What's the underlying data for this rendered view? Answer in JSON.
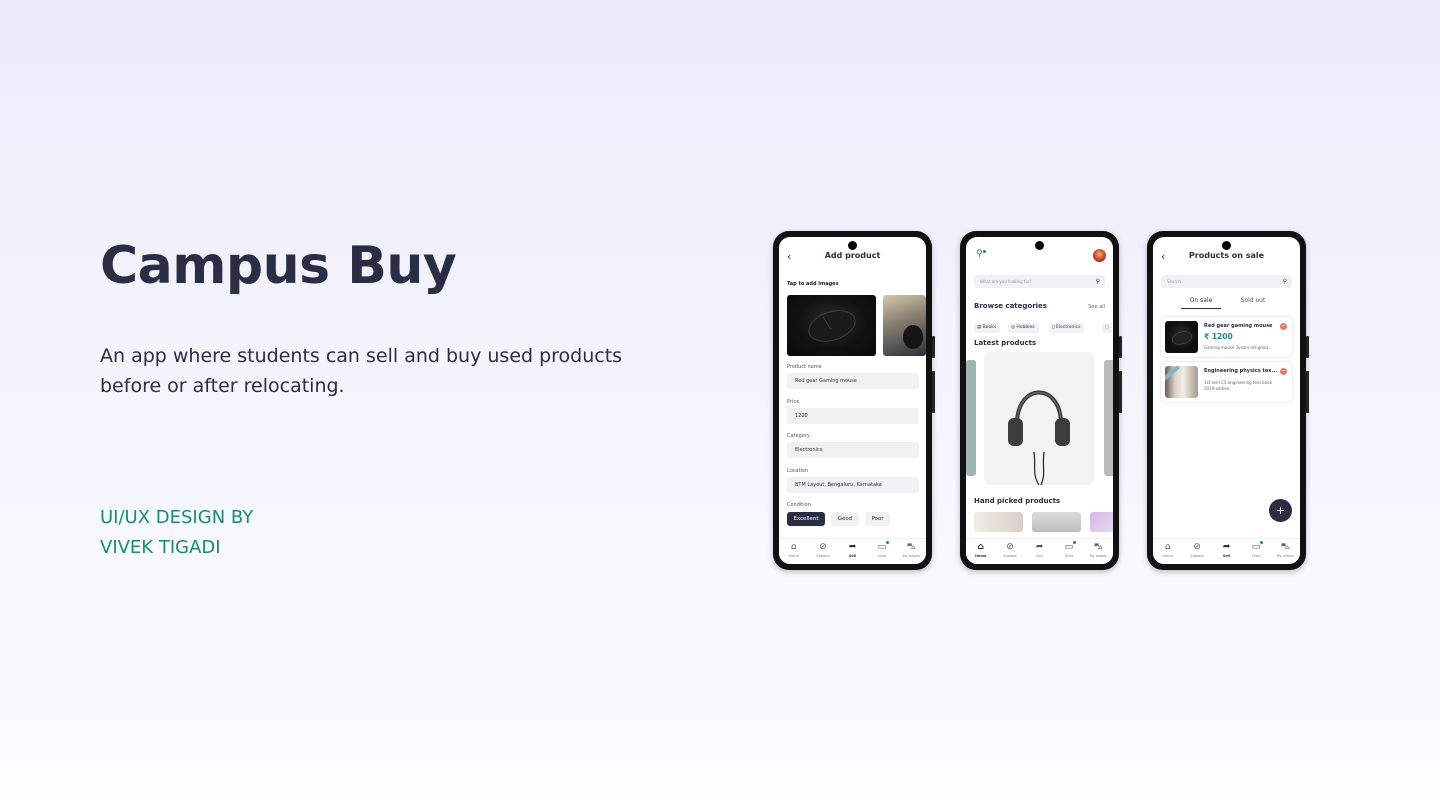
{
  "hero": {
    "title": "Campus Buy",
    "description": "An app where students can sell and buy used products before or after relocating.",
    "credit_line1": "UI/UX DESIGN BY",
    "credit_line2": "VIVEK TIGADI"
  },
  "colors": {
    "accent": "#1a8a78",
    "dark": "#2b2d45",
    "danger": "#e4786b"
  },
  "tabbar": {
    "home": "Home",
    "explore": "Explore",
    "sell": "Sell",
    "chat": "Chat",
    "orders": "My orders",
    "home_icon": "home-icon",
    "explore_icon": "compass-icon",
    "sell_icon": "share-arrow-icon",
    "chat_icon": "chat-icon",
    "orders_icon": "cart-icon"
  },
  "add_product": {
    "title": "Add product",
    "back_icon": "chevron-left-icon",
    "images_label": "Tap to add images",
    "product_name_label": "Product name",
    "product_name_value": "Red gear Gaming mouse",
    "price_label": "Price",
    "price_value": "1200",
    "category_label": "Category",
    "category_value": "Electronics",
    "location_label": "Location",
    "location_value": "BTM Layout, Bengaluru, Karnataka",
    "condition_label": "Condition",
    "conditions": [
      "Excellent",
      "Good",
      "Poor"
    ]
  },
  "home": {
    "search_placeholder": "What are you looking for?",
    "browse_title": "Browse categories",
    "see_all": "See all",
    "categories": [
      "Books",
      "Hobbies",
      "Electronics"
    ],
    "latest_title": "Latest products",
    "handpicked_title": "Hand picked products"
  },
  "on_sale": {
    "title": "Products on sale",
    "search_placeholder": "Search",
    "tab_on_sale": "On sale",
    "tab_sold_out": "Sold out",
    "items": [
      {
        "name": "Red gear gaming mouse",
        "price": "₹ 1200",
        "desc": "Gaming mouse 3years old good..."
      },
      {
        "name": "Engineering physics tex...",
        "desc_line1": "1st sem CS engineering text book",
        "desc_line2": "2019 edition."
      }
    ],
    "fab_label": "+"
  }
}
